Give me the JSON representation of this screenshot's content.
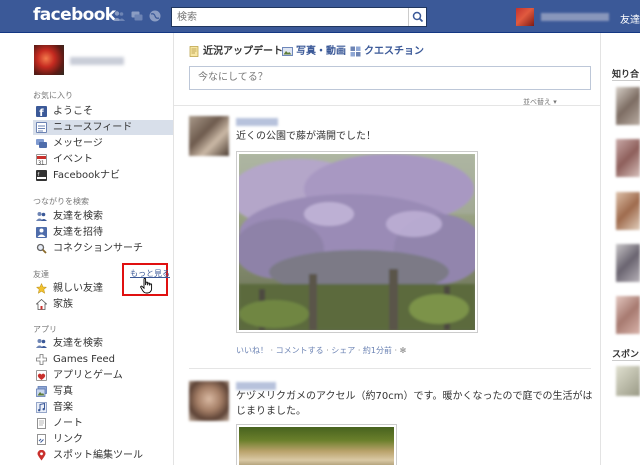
{
  "topbar": {
    "logo": "facebook",
    "search_placeholder": "検索",
    "right_link": "友達を"
  },
  "sidebar": {
    "favorites_title": "お気に入り",
    "favorites": [
      {
        "label": "ようこそ",
        "icon": "facebook-icon",
        "color": "#3b5998"
      },
      {
        "label": "ニュースフィード",
        "icon": "newsfeed-icon",
        "color": "#6d84b4",
        "selected": true
      },
      {
        "label": "メッセージ",
        "icon": "messages-icon",
        "color": "#5a7bbd"
      },
      {
        "label": "イベント",
        "icon": "events-icon",
        "color": "#c9302c"
      },
      {
        "label": "Facebookナビ",
        "icon": "navi-icon",
        "color": "#333333"
      }
    ],
    "connect_title": "つながりを検索",
    "connect": [
      {
        "label": "友達を検索",
        "icon": "friends-icon"
      },
      {
        "label": "友達を招待",
        "icon": "invite-icon"
      },
      {
        "label": "コネクションサーチ",
        "icon": "search-icon"
      }
    ],
    "friends_title": "友達",
    "more_link": "もっと見る",
    "friends": [
      {
        "label": "親しい友達",
        "icon": "star-icon"
      },
      {
        "label": "家族",
        "icon": "home-icon"
      }
    ],
    "apps_title": "アプリ",
    "apps": [
      {
        "label": "友達を検索",
        "icon": "friends-icon"
      },
      {
        "label": "Games Feed",
        "icon": "games-icon"
      },
      {
        "label": "アプリとゲーム",
        "icon": "apps-icon"
      },
      {
        "label": "写真",
        "icon": "photos-icon"
      },
      {
        "label": "音楽",
        "icon": "music-icon"
      },
      {
        "label": "ノート",
        "icon": "notes-icon"
      },
      {
        "label": "リンク",
        "icon": "links-icon"
      },
      {
        "label": "スポット編集ツール",
        "icon": "places-icon"
      }
    ]
  },
  "composer": {
    "tab_status": "近況アップデート",
    "tab_photo": "写真・動画",
    "tab_question": "クエスチョン",
    "placeholder": "今なにしてる？"
  },
  "feed": {
    "sort_label": "並べ替え ▾",
    "stories": [
      {
        "message": "近くの公園で藤が満開でした！",
        "actions": {
          "like": "いいね！",
          "comment": "コメントする",
          "share": "シェア",
          "time": "約1分前"
        }
      },
      {
        "message": "ケヅメリクガメのアクセル（約70cm）です。暖かくなったので庭での生活がはじまりました。"
      }
    ]
  },
  "right_column": {
    "title_a": "知り合",
    "title_b": "スポン"
  },
  "colors": {
    "brand": "#3b5998",
    "selected_bg": "#d8dfea",
    "link": "#3b5998",
    "highlight_box": "#e01010"
  }
}
